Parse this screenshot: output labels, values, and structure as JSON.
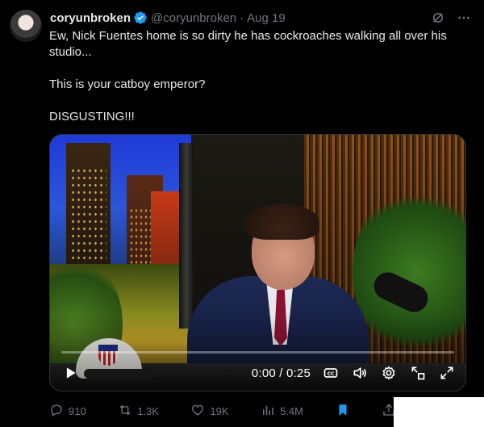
{
  "author": {
    "display_name": "coryunbroken",
    "handle": "@coryunbroken",
    "separator": "·",
    "time": "Aug 19"
  },
  "tweet": {
    "lines": [
      "Ew, Nick Fuentes home is so dirty he has cockroaches walking all over his studio...",
      "This is your catboy emperor?",
      "DISGUSTING!!!"
    ]
  },
  "video": {
    "time_readout": "0:00 / 0:25",
    "progress_fraction": 0.0
  },
  "actions": {
    "replies": "910",
    "reposts": "1.3K",
    "likes": "19K",
    "views": "5.4M"
  },
  "colors": {
    "accent": "#1d9bf0",
    "muted": "#71767b",
    "text": "#e7e9ea",
    "background": "#000000"
  },
  "icons": [
    "verified-badge-icon",
    "grok-icon",
    "more-icon",
    "play-icon",
    "captions-icon",
    "volume-icon",
    "settings-icon",
    "minimize-icon",
    "fullscreen-icon",
    "reply-icon",
    "repost-icon",
    "like-icon",
    "views-icon",
    "bookmark-icon",
    "share-icon"
  ]
}
